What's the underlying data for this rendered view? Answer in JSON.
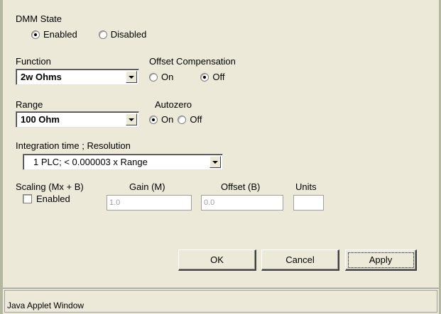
{
  "dmm_state": {
    "label": "DMM State",
    "enabled_label": "Enabled",
    "disabled_label": "Disabled",
    "selected": "Enabled"
  },
  "function": {
    "label": "Function",
    "value": "2w Ohms"
  },
  "offset_compensation": {
    "label": "Offset Compensation",
    "on_label": "On",
    "off_label": "Off",
    "selected": "Off"
  },
  "range": {
    "label": "Range",
    "value": "100 Ohm"
  },
  "autozero": {
    "label": "Autozero",
    "on_label": "On",
    "off_label": "Off",
    "selected": "On"
  },
  "integration": {
    "label": "Integration time ; Resolution",
    "value": "1   PLC; < 0.000003 x Range"
  },
  "scaling": {
    "label": "Scaling (Mx + B)",
    "enabled_label": "Enabled",
    "enabled_checked": false,
    "gain_label": "Gain (M)",
    "gain_value": "1.0",
    "offset_label": "Offset (B)",
    "offset_value": "0.0",
    "units_label": "Units",
    "units_value": ""
  },
  "buttons": {
    "ok": "OK",
    "cancel": "Cancel",
    "apply": "Apply"
  },
  "status_bar": {
    "text": "Java Applet Window"
  }
}
